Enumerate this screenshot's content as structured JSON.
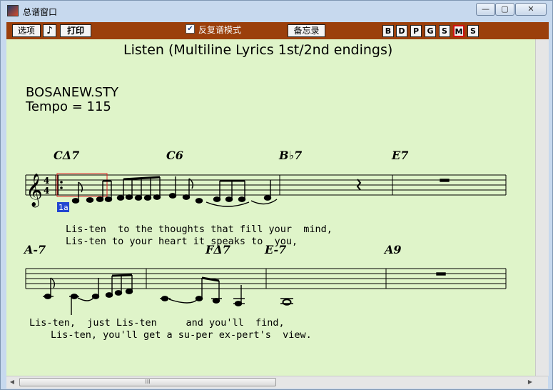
{
  "window": {
    "title": "总谱窗口"
  },
  "window_controls": {
    "minimize": "—",
    "maximize": "▢",
    "close": "✕"
  },
  "toolbar": {
    "options_label": "选项",
    "note_label": "♪",
    "print_label": "打印",
    "repeat_checkbox_label": "反复谱模式",
    "repeat_checked": true,
    "memo_label": "备忘录",
    "track_buttons": [
      "B",
      "D",
      "P",
      "G",
      "S",
      "M",
      "S"
    ]
  },
  "score": {
    "title": "Listen (Multiline Lyrics 1st/2nd endings)",
    "style": "BOSANEW.STY",
    "tempo": "Tempo = 115",
    "bar_number": "1a",
    "time_signature": {
      "top": "4",
      "bottom": "4"
    },
    "system1": {
      "chords": [
        "CΔ7",
        "C6",
        "B♭7",
        "E7"
      ],
      "lyric_line1": "Lis-ten  to the thoughts that fill your  mind,",
      "lyric_line2": "Lis-ten to your heart it speaks to  you,"
    },
    "system2": {
      "chords": [
        "A-7",
        "FΔ7",
        "E-7",
        "A9"
      ],
      "lyric_line1": "Lis-ten,  just Lis-ten     and you'll  find,",
      "lyric_line2": "Lis-ten, you'll get a su-per ex-pert's  view."
    }
  },
  "scrollbar": {
    "h_thumb_grip": "III"
  }
}
